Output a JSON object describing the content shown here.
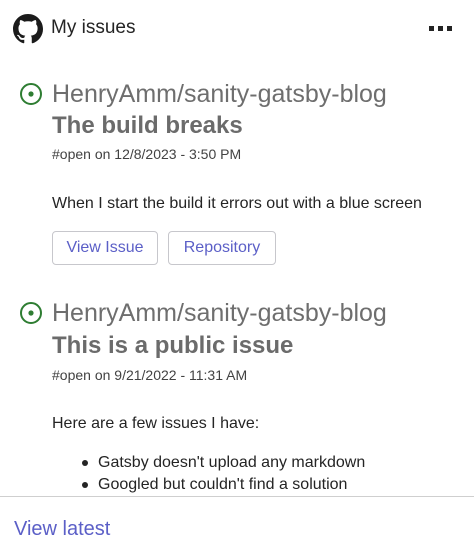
{
  "header": {
    "title": "My issues",
    "logo_icon": "github-icon",
    "more_icon": "more-horizontal-icon"
  },
  "colors": {
    "accent": "#5b5fc7",
    "open_status": "#2e7d32",
    "muted_text": "#6e6e6e"
  },
  "issues": [
    {
      "status_icon": "issue-open-icon",
      "repo": "HenryAmm/sanity-gatsby-blog",
      "title": "The build breaks",
      "meta": "#open on 12/8/2023 - 3:50 PM",
      "body": "When I start the build it errors out with a blue screen",
      "actions": {
        "view_issue": "View Issue",
        "repository": "Repository"
      }
    },
    {
      "status_icon": "issue-open-icon",
      "repo": "HenryAmm/sanity-gatsby-blog",
      "title": "This is a public issue",
      "meta": "#open on 9/21/2022 - 11:31 AM",
      "body": "Here are a few issues I have:",
      "bullets": [
        "Gatsby doesn't upload any markdown",
        "Googled but couldn't find a solution"
      ]
    }
  ],
  "footer": {
    "link": "View latest"
  }
}
